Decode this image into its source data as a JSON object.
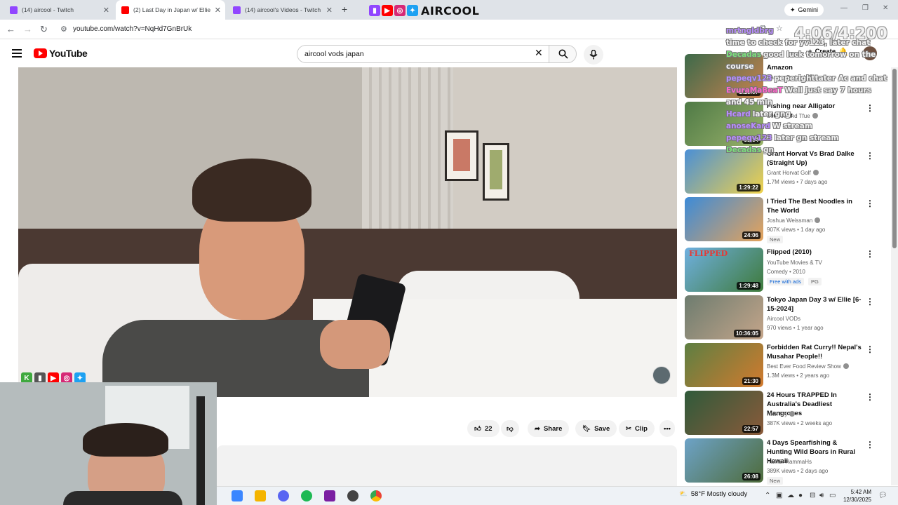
{
  "browser": {
    "tabs": [
      {
        "label": "(14) aircool - Twitch",
        "active": false
      },
      {
        "label": "(2) Last Day in Japan w/ Ellie [6",
        "active": true
      },
      {
        "label": "(14) aircool's Videos - Twitch",
        "active": false
      }
    ],
    "new_tab": "+",
    "brand_text": "AIRCOOL",
    "gemini_label": "Gemini",
    "url": "youtube.com/watch?v=NqHd7GnBrUk"
  },
  "youtube": {
    "logo_text": "YouTube",
    "search_value": "aircool vods japan",
    "create_label": "Create"
  },
  "actions": {
    "like_count": "22",
    "share_label": "Share",
    "save_label": "Save",
    "clip_label": "Clip"
  },
  "recommendations": [
    {
      "title": "Amazon",
      "channel": "Xander Budnick",
      "verified": true,
      "meta": "",
      "duration": "1:25:07",
      "badge": ""
    },
    {
      "title": "Fishing near Alligator Alcatraz",
      "channel": "SeaFue and Tfue",
      "verified": true,
      "meta": "",
      "duration": "31:54",
      "badge": ""
    },
    {
      "title": "Grant Horvat Vs Brad Dalke (Straight Up)",
      "channel": "Grant Horvat Golf",
      "verified": true,
      "meta": "1.7M views • 7 days ago",
      "duration": "1:29:22",
      "badge": ""
    },
    {
      "title": "I Tried The Best Noodles in The World",
      "channel": "Joshua Weissman",
      "verified": true,
      "meta": "907K views • 1 day ago",
      "duration": "24:06",
      "badge": "New"
    },
    {
      "title": "Flipped (2010)",
      "channel": "YouTube Movies & TV",
      "verified": false,
      "meta": "Comedy • 2010",
      "duration": "1:29:48",
      "badge": "Free with ads",
      "badge2": "PG"
    },
    {
      "title": "Tokyo Japan Day 3 w/ Ellie [6-15-2024]",
      "channel": "Aircool VODs",
      "verified": false,
      "meta": "970 views • 1 year ago",
      "duration": "10:36:05",
      "badge": ""
    },
    {
      "title": "Forbidden Rat Curry!! Nepal's Musahar People!!",
      "channel": "Best Ever Food Review Show",
      "verified": true,
      "meta": "1.3M views • 2 years ago",
      "duration": "21:30",
      "badge": ""
    },
    {
      "title": "24 Hours TRAPPED In Australia's Deadliest Mangroves",
      "channel": "Nick Fry",
      "verified": true,
      "meta": "387K views • 2 weeks ago",
      "duration": "22:57",
      "badge": ""
    },
    {
      "title": "4 Days Spearfishing & Hunting Wild Boars in Rural Hawaii",
      "channel": "Hawaii HammaHs",
      "verified": false,
      "meta": "389K views • 2 days ago",
      "duration": "26:08",
      "badge": "New"
    }
  ],
  "thumb_flipped_text": "FLIPPED",
  "chat": {
    "viewer_count": "4:06/4:200",
    "lines": [
      {
        "user": "mrtngldbrg",
        "color": "#b88cff",
        "text": ""
      },
      {
        "user": "",
        "color": "#ffffff",
        "text": "time to check for yv123, later chat"
      },
      {
        "user": "Decadas",
        "color": "#7be07b",
        "text": "good luck tomorrow on the"
      },
      {
        "user": "",
        "color": "#ffffff",
        "text": "course"
      },
      {
        "user": "pepeqv123",
        "color": "#b88cff",
        "text": "peperighttater Ac and chat"
      },
      {
        "user": "EvuraMaBeaT",
        "color": "#ff66cc",
        "text": "Well just say 7 hours"
      },
      {
        "user": "",
        "color": "#ffffff",
        "text": "and 45 min"
      },
      {
        "user": "Hcard",
        "color": "#b88cff",
        "text": "later gng"
      },
      {
        "user": "anoseKard",
        "color": "#b88cff",
        "text": "W stream"
      },
      {
        "user": "pepeqv123",
        "color": "#b88cff",
        "text": "later gn stream"
      },
      {
        "user": "Decadas",
        "color": "#7be07b",
        "text": "gn"
      }
    ]
  },
  "taskbar": {
    "weather": "58°F  Mostly cloudy",
    "time": "5:42 AM",
    "date": "12/30/2025"
  }
}
